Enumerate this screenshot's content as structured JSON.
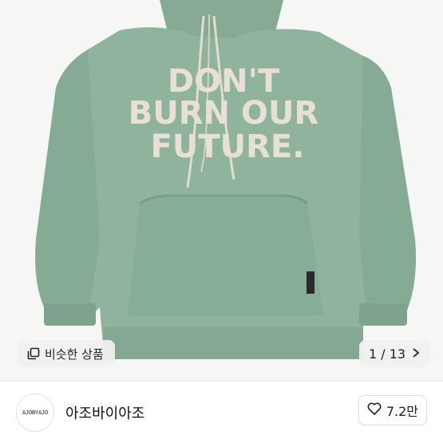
{
  "photo": {
    "alt_icon": "product-photo",
    "garment_color": "#8fb39c",
    "graphic_lines": [
      "DON'T",
      "BURN OUR",
      "FUTURE."
    ],
    "tag_text": "AJOBYAJO"
  },
  "similar": {
    "label": "비슷한 상품",
    "icon": "copy-icon"
  },
  "pager": {
    "current": "1",
    "separator": "/",
    "total": "13",
    "text": "1 / 13",
    "chevron": "chevron-right-icon"
  },
  "seller": {
    "name": "아조바이아조",
    "avatar_text": "AJOBYAJO"
  },
  "like": {
    "icon": "heart-icon",
    "count": "7.2만"
  }
}
